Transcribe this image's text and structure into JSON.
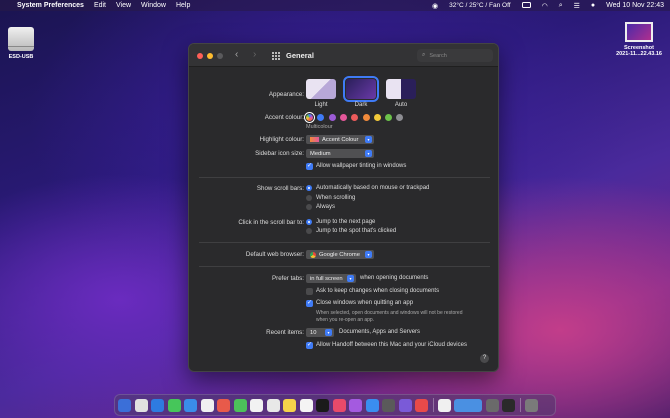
{
  "menubar": {
    "app_name": "System Preferences",
    "items": [
      "Edit",
      "View",
      "Window",
      "Help"
    ],
    "temps": "32°C / 25°C / Fan Off",
    "datetime": "Wed 10 Nov  22:43"
  },
  "desktop": {
    "disk_label": "ESD-USB",
    "screenshot_label_1": "Screenshot",
    "screenshot_label_2": "2021-11...22.43.16"
  },
  "window": {
    "title": "General",
    "search_placeholder": "Search"
  },
  "general": {
    "appearance_label": "Appearance:",
    "appearance_options": [
      "Light",
      "Dark",
      "Auto"
    ],
    "appearance_selected": "Dark",
    "accent_label": "Accent colour:",
    "accent_caption": "Multicolour",
    "accent_colors": [
      "#b8a0e0",
      "#3f7bf6",
      "#9b5bd6",
      "#e4579a",
      "#ec5b5b",
      "#f08a3b",
      "#f2c93a",
      "#6cc24a",
      "#8e8e93"
    ],
    "highlight_label": "Highlight colour:",
    "highlight_value": "Accent Colour",
    "sidebar_label": "Sidebar icon size:",
    "sidebar_value": "Medium",
    "wallpaper_tint": "Allow wallpaper tinting in windows",
    "scroll_label": "Show scroll bars:",
    "scroll_options": [
      "Automatically based on mouse or trackpad",
      "When scrolling",
      "Always"
    ],
    "click_label": "Click in the scroll bar to:",
    "click_options": [
      "Jump to the next page",
      "Jump to the spot that's clicked"
    ],
    "browser_label": "Default web browser:",
    "browser_value": "Google Chrome",
    "tabs_label": "Prefer tabs:",
    "tabs_value": "in full screen",
    "tabs_suffix": "when opening documents",
    "ask_keep": "Ask to keep changes when closing documents",
    "close_windows": "Close windows when quitting an app",
    "close_hint_1": "When selected, open documents and windows will not be restored",
    "close_hint_2": "when you re-open an app.",
    "recent_label": "Recent items:",
    "recent_value": "10",
    "recent_suffix": "Documents, Apps and Servers",
    "handoff": "Allow Handoff between this Mac and your iCloud devices",
    "help": "?"
  },
  "dock": {
    "apps": [
      "#3b6fd8",
      "#e0e0e0",
      "#2e7be0",
      "#46c65a",
      "#3a8de8",
      "#f0f0f0",
      "#e85a4a",
      "#4cc05a",
      "#f2f2f2",
      "#e8e8e8",
      "#f5d24a",
      "#f4f4f4",
      "#1a1a1a",
      "#e84a6a",
      "#a45ae0",
      "#3a8ef0",
      "#5a5a5a",
      "#7a5ad8",
      "#e84a4a",
      "#f0f0f0",
      "#4a90e2",
      "#6a6a6a",
      "#2a2a2a",
      "#7a7a7a"
    ]
  }
}
